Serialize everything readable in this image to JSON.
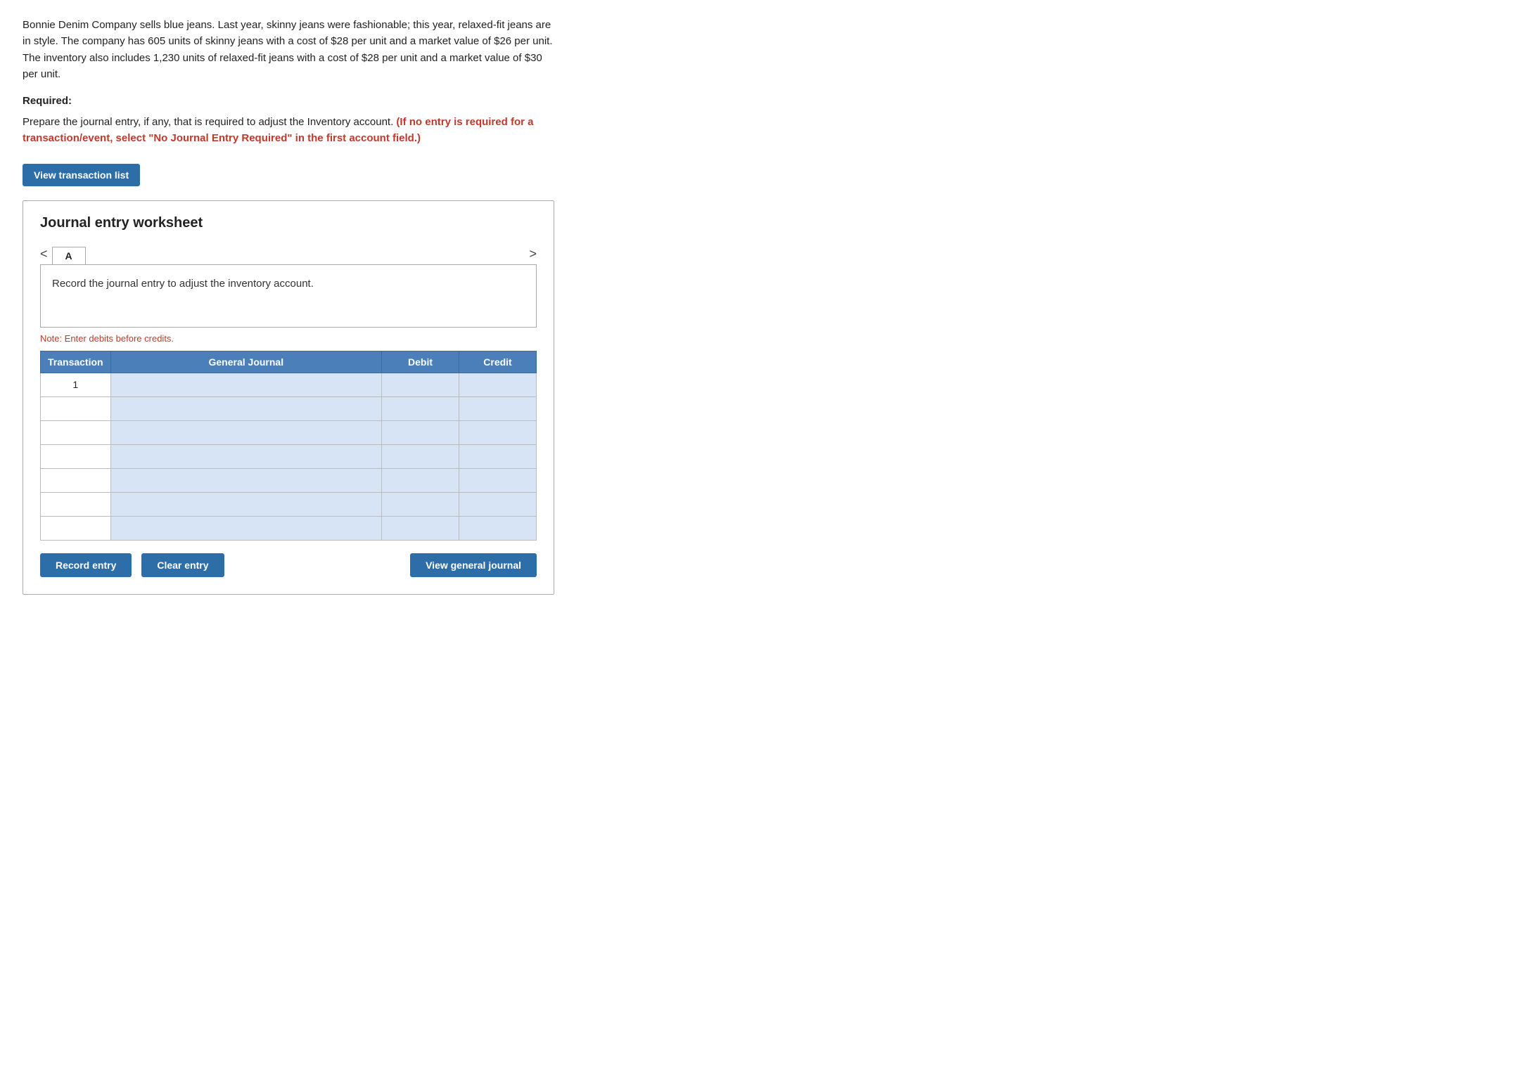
{
  "intro": {
    "paragraph": "Bonnie Denim Company sells blue jeans. Last year, skinny jeans were fashionable; this year, relaxed-fit jeans are in style. The company has 605 units of skinny jeans with a cost of $28 per unit and a market value of $26 per unit. The inventory also includes 1,230 units of relaxed-fit jeans with a cost of $28 per unit and a market value of $30 per unit."
  },
  "required": {
    "heading": "Required:",
    "instruction_plain": "Prepare the journal entry, if any, that is required to adjust the Inventory account. ",
    "instruction_red": "(If no entry is required for a transaction/event, select \"No Journal Entry Required\" in the first account field.)"
  },
  "view_transaction_btn": "View transaction list",
  "worksheet": {
    "title": "Journal entry worksheet",
    "tab_left_arrow": "<",
    "tab_right_arrow": ">",
    "tab_label": "A",
    "description": "Record the journal entry to adjust the inventory account.",
    "note": "Note: Enter debits before credits.",
    "table": {
      "headers": [
        "Transaction",
        "General Journal",
        "Debit",
        "Credit"
      ],
      "rows": [
        {
          "transaction": "1",
          "gj": "",
          "debit": "",
          "credit": ""
        },
        {
          "transaction": "",
          "gj": "",
          "debit": "",
          "credit": ""
        },
        {
          "transaction": "",
          "gj": "",
          "debit": "",
          "credit": ""
        },
        {
          "transaction": "",
          "gj": "",
          "debit": "",
          "credit": ""
        },
        {
          "transaction": "",
          "gj": "",
          "debit": "",
          "credit": ""
        },
        {
          "transaction": "",
          "gj": "",
          "debit": "",
          "credit": ""
        },
        {
          "transaction": "",
          "gj": "",
          "debit": "",
          "credit": ""
        }
      ]
    },
    "buttons": {
      "record": "Record entry",
      "clear": "Clear entry",
      "view_journal": "View general journal"
    }
  }
}
